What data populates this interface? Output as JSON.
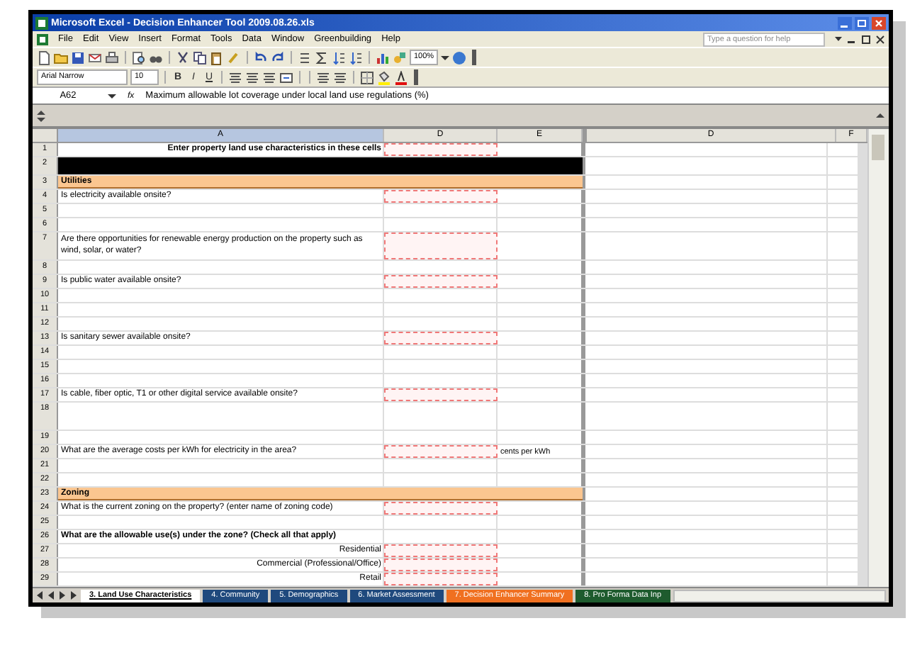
{
  "window": {
    "title": "Microsoft Excel - Decision Enhancer Tool 2009.08.26.xls"
  },
  "menu": [
    "File",
    "Edit",
    "View",
    "Insert",
    "Format",
    "Tools",
    "Data",
    "Window",
    "Greenbuilding",
    "Help"
  ],
  "help_box": {
    "placeholder": "Type a question for help"
  },
  "toolbar": {
    "zoom": "100%"
  },
  "format_bar": {
    "font": "Arial Narrow",
    "size": "10",
    "bold": "B",
    "italic": "I",
    "underline": "U"
  },
  "formula_bar": {
    "name_box": "A62",
    "fx": "fx",
    "formula": "Maximum allowable lot coverage under local land use regulations (%)"
  },
  "columns": [
    {
      "label": "A",
      "selected": true
    },
    {
      "label": "D",
      "selected": false
    },
    {
      "label": "E",
      "selected": false
    },
    {
      "label": "D",
      "selected": false
    },
    {
      "label": "F",
      "selected": false
    }
  ],
  "rows": [
    {
      "num": "1",
      "kind": "title",
      "text": "Enter property land use characteristics in these cells",
      "input": true
    },
    {
      "num": "2",
      "kind": "band"
    },
    {
      "num": "3",
      "kind": "section",
      "text": "Utilities"
    },
    {
      "num": "4",
      "kind": "question",
      "text": "Is electricity available onsite?",
      "input": true
    },
    {
      "num": "5",
      "kind": "blank"
    },
    {
      "num": "6",
      "kind": "blank"
    },
    {
      "num": "7",
      "kind": "question",
      "tall": true,
      "text": "Are there opportunities for renewable energy production on the property such as wind, solar, or water?",
      "input": true
    },
    {
      "num": "8",
      "kind": "blank"
    },
    {
      "num": "9",
      "kind": "question",
      "text": "Is public water available onsite?",
      "input": true
    },
    {
      "num": "10",
      "kind": "blank"
    },
    {
      "num": "11",
      "kind": "blank"
    },
    {
      "num": "12",
      "kind": "blank"
    },
    {
      "num": "13",
      "kind": "question",
      "text": "Is sanitary sewer available onsite?",
      "input": true
    },
    {
      "num": "14",
      "kind": "blank"
    },
    {
      "num": "15",
      "kind": "blank"
    },
    {
      "num": "16",
      "kind": "blank"
    },
    {
      "num": "17",
      "kind": "question",
      "text": "Is cable, fiber optic, T1 or other digital service available onsite?",
      "input": true
    },
    {
      "num": "18",
      "kind": "blank",
      "tall": true
    },
    {
      "num": "19",
      "kind": "blank"
    },
    {
      "num": "20",
      "kind": "question",
      "text": "What are the average costs per kWh for electricity in the area?",
      "input": true,
      "unit": "cents per kWh"
    },
    {
      "num": "21",
      "kind": "blank"
    },
    {
      "num": "22",
      "kind": "blank"
    },
    {
      "num": "23",
      "kind": "section",
      "text": "Zoning"
    },
    {
      "num": "24",
      "kind": "question",
      "text": "What is the current zoning on the property? (enter name of zoning code)",
      "input": true
    },
    {
      "num": "25",
      "kind": "blank"
    },
    {
      "num": "26",
      "kind": "heading",
      "text": "What are the allowable use(s) under the zone? (Check all that apply)"
    },
    {
      "num": "27",
      "kind": "option",
      "text": "Residential",
      "input": true
    },
    {
      "num": "28",
      "kind": "option",
      "text": "Commercial (Professional/Office)",
      "input": true
    },
    {
      "num": "29",
      "kind": "option",
      "text": "Retail",
      "input": true
    }
  ],
  "tabs": [
    {
      "label": "3. Land Use Characteristics",
      "selected": true
    },
    {
      "label": "4. Community",
      "selected": false,
      "color": "#1f497d"
    },
    {
      "label": "5. Demographics",
      "selected": false,
      "color": "#1f497d"
    },
    {
      "label": "6. Market Assessment",
      "selected": false,
      "color": "#1f497d"
    },
    {
      "label": "7. Decision Enhancer Summary",
      "selected": false,
      "color": "#f07020"
    },
    {
      "label": "8. Pro Forma Data Inp",
      "selected": false,
      "color": "#1e5b2e"
    }
  ]
}
